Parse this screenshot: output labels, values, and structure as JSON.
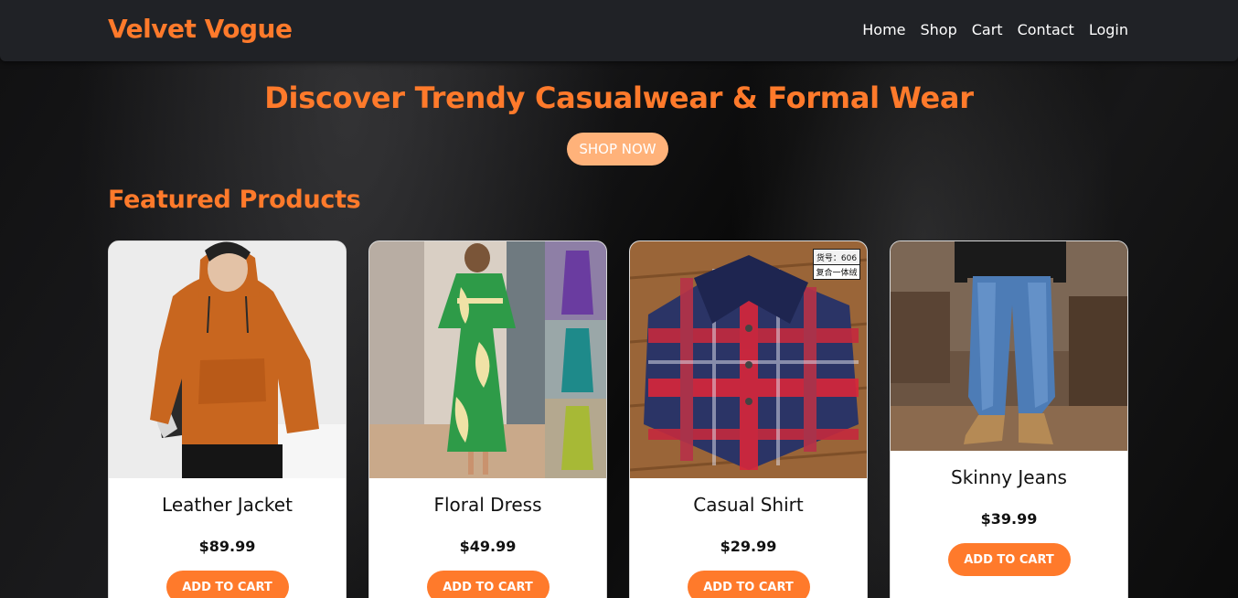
{
  "nav": {
    "brand": "Velvet Vogue",
    "links": [
      "Home",
      "Shop",
      "Cart",
      "Contact",
      "Login"
    ]
  },
  "hero": {
    "title": "Discover Trendy Casualwear & Formal Wear",
    "cta": "SHOP NOW"
  },
  "featured": {
    "title": "Featured Products",
    "products": [
      {
        "name": "Leather Jacket",
        "price": "$89.99",
        "button": "ADD TO CART",
        "image": "orange-jacket-photo"
      },
      {
        "name": "Floral Dress",
        "price": "$49.99",
        "button": "ADD TO CART",
        "image": "green-dress-photo"
      },
      {
        "name": "Casual Shirt",
        "price": "$29.99",
        "button": "ADD TO CART",
        "image": "plaid-shirt-photo",
        "image_tag": [
          "货号：606",
          "复合一体绒"
        ]
      },
      {
        "name": "Skinny Jeans",
        "price": "$39.99",
        "button": "ADD TO CART",
        "image": "blue-jeans-photo"
      }
    ]
  },
  "colors": {
    "accent": "#ff7a2b",
    "cta_light": "#ffb27a",
    "navbar": "#202226"
  }
}
